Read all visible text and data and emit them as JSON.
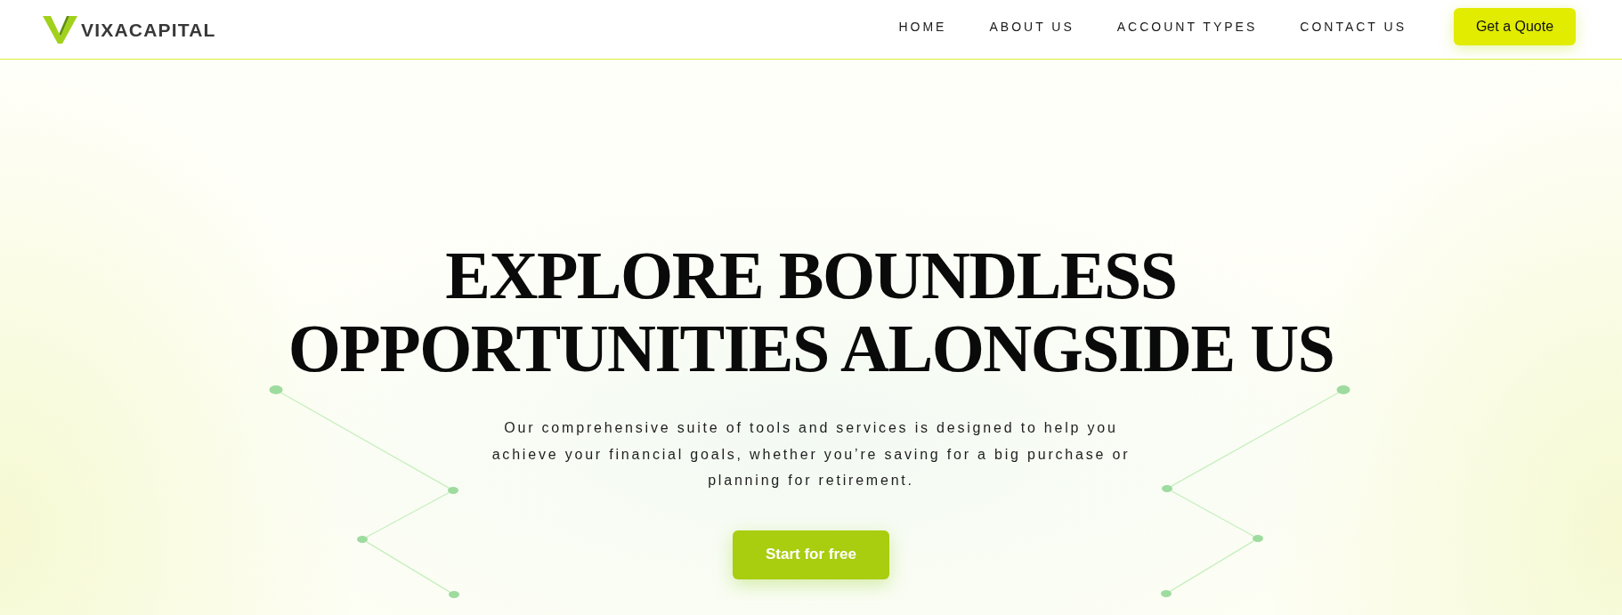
{
  "header": {
    "logo_text": "VIXACAPITAL",
    "nav": [
      {
        "label": "HOME"
      },
      {
        "label": "ABOUT US"
      },
      {
        "label": "ACCOUNT TYPES"
      },
      {
        "label": "CONTACT US"
      }
    ],
    "cta_button": "Get a Quote"
  },
  "hero": {
    "heading": "EXPLORE BOUNDLESS OPPORTUNITIES ALONGSIDE US",
    "description": "Our comprehensive suite of tools and services is designed to help you achieve your financial goals, whether you’re saving for a big purchase or planning for retirement.",
    "button": "Start for free"
  }
}
